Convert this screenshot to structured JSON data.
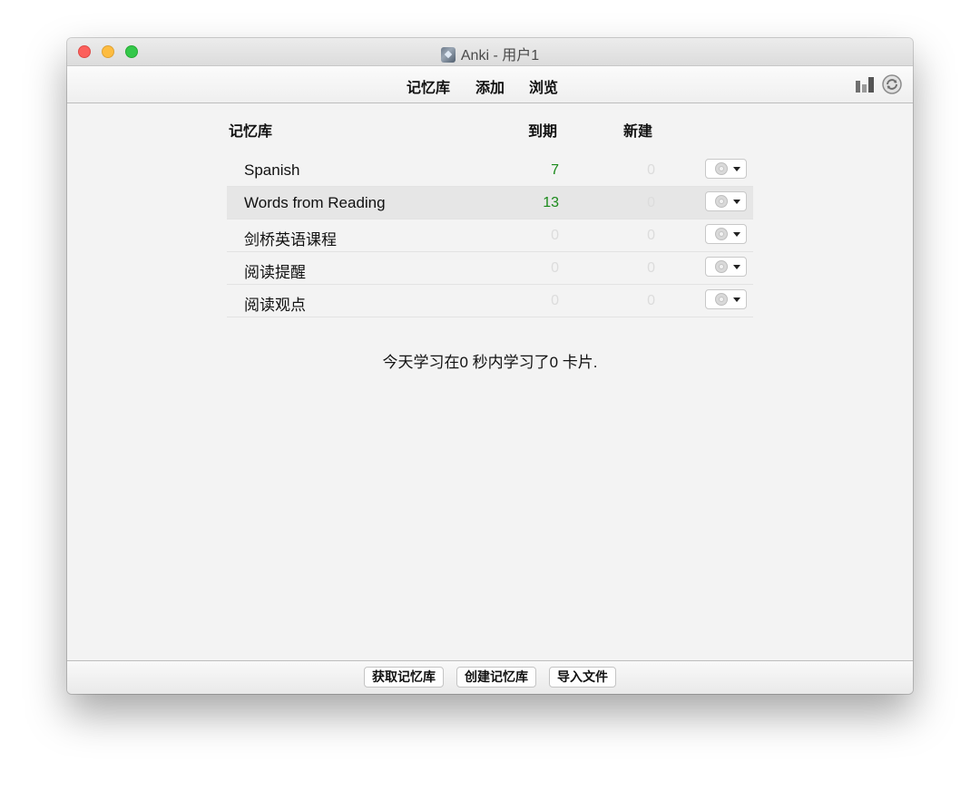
{
  "window": {
    "title": "Anki - 用户1"
  },
  "toolbar": {
    "decks_label": "记忆库",
    "add_label": "添加",
    "browse_label": "浏览"
  },
  "table": {
    "headers": {
      "deck": "记忆库",
      "due": "到期",
      "new": "新建"
    },
    "rows": [
      {
        "name": "Spanish",
        "due": "7",
        "new": "0",
        "current": false
      },
      {
        "name": "Words from Reading",
        "due": "13",
        "new": "0",
        "current": true
      },
      {
        "name": "剑桥英语课程",
        "due": "0",
        "new": "0",
        "current": false
      },
      {
        "name": "阅读提醒",
        "due": "0",
        "new": "0",
        "current": false
      },
      {
        "name": "阅读观点",
        "due": "0",
        "new": "0",
        "current": false
      }
    ]
  },
  "summary": "今天学习在0 秒内学习了0 卡片.",
  "bottom": {
    "get_shared_label": "获取记忆库",
    "create_deck_label": "创建记忆库",
    "import_file_label": "导入文件"
  },
  "colors": {
    "due_nonzero": "#1a8a1a",
    "zero": "#dcdcdc",
    "current_row": "#e6e6e6"
  },
  "icons": {
    "stats": "bar-chart-icon",
    "sync": "sync-icon",
    "deck_options": "gear-icon"
  }
}
